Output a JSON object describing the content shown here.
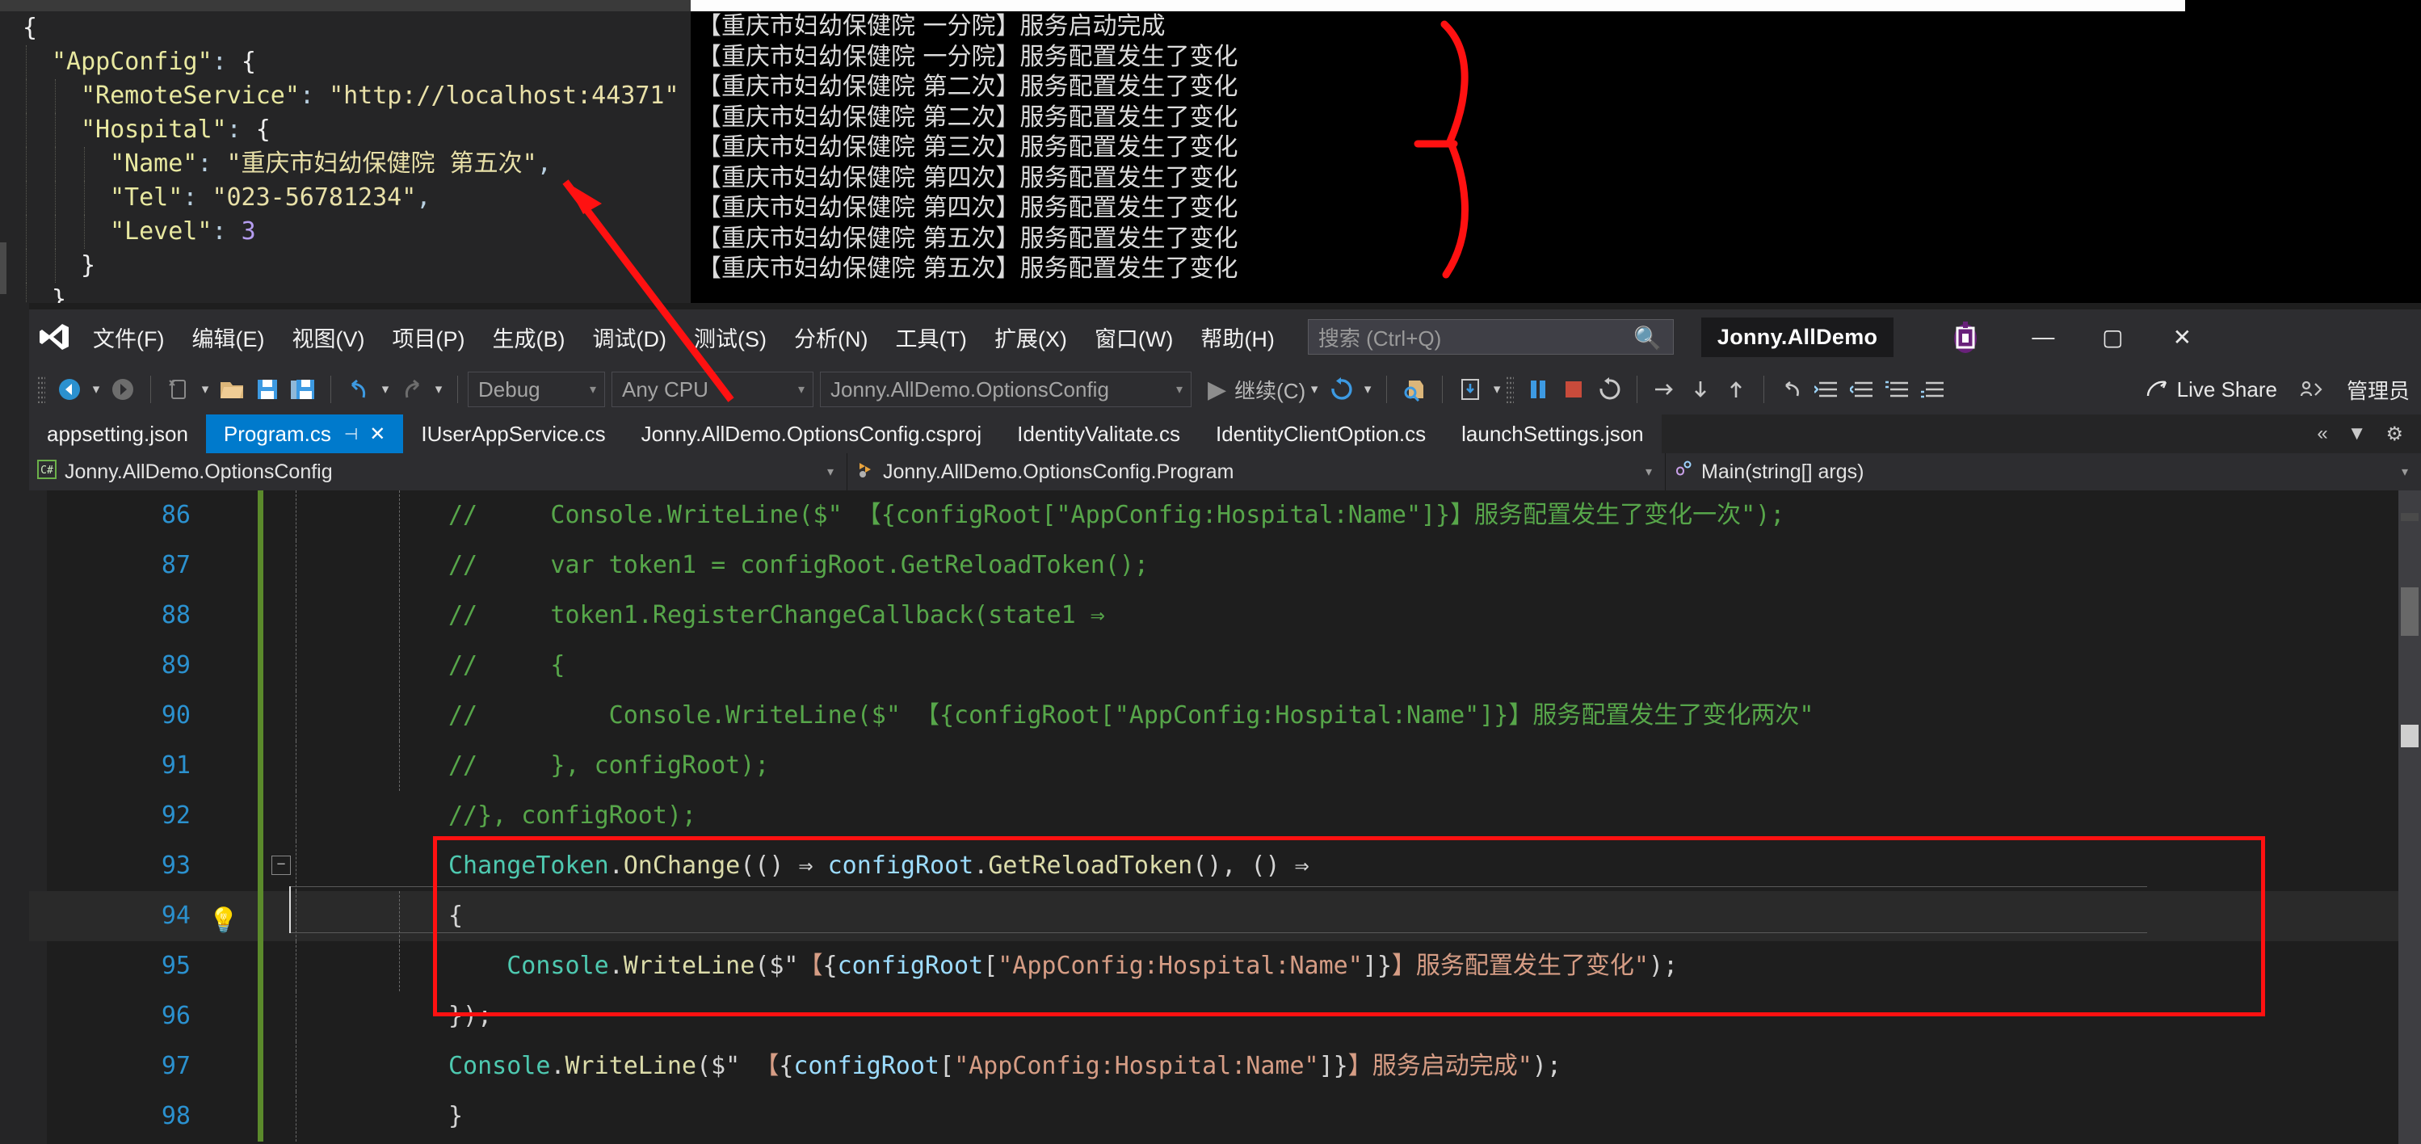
{
  "json_editor": {
    "name": "appsetting.json",
    "lines": [
      {
        "indent": 0,
        "segs": [
          {
            "c": "j-brace",
            "t": "{"
          }
        ]
      },
      {
        "indent": 1,
        "segs": [
          {
            "c": "j-key",
            "t": "\"AppConfig\""
          },
          {
            "c": "j-punct",
            "t": ": "
          },
          {
            "c": "j-brace",
            "t": "{"
          }
        ]
      },
      {
        "indent": 2,
        "segs": [
          {
            "c": "j-key",
            "t": "\"RemoteService\""
          },
          {
            "c": "j-punct",
            "t": ": "
          },
          {
            "c": "j-str",
            "t": "\"http://localhost:44371\""
          }
        ]
      },
      {
        "indent": 2,
        "segs": [
          {
            "c": "j-key",
            "t": "\"Hospital\""
          },
          {
            "c": "j-punct",
            "t": ": "
          },
          {
            "c": "j-brace",
            "t": "{"
          }
        ]
      },
      {
        "indent": 3,
        "segs": [
          {
            "c": "j-key",
            "t": "\"Name\""
          },
          {
            "c": "j-punct",
            "t": ": "
          },
          {
            "c": "j-str",
            "t": "\"重庆市妇幼保健院 第五次\""
          },
          {
            "c": "j-punct",
            "t": ","
          }
        ]
      },
      {
        "indent": 3,
        "segs": [
          {
            "c": "j-key",
            "t": "\"Tel\""
          },
          {
            "c": "j-punct",
            "t": ": "
          },
          {
            "c": "j-str",
            "t": "\"023-56781234\""
          },
          {
            "c": "j-punct",
            "t": ","
          }
        ]
      },
      {
        "indent": 3,
        "segs": [
          {
            "c": "j-key",
            "t": "\"Level\""
          },
          {
            "c": "j-punct",
            "t": ": "
          },
          {
            "c": "j-num",
            "t": "3"
          }
        ]
      },
      {
        "indent": 2,
        "segs": [
          {
            "c": "j-brace",
            "t": "}"
          }
        ]
      },
      {
        "indent": 1,
        "segs": [
          {
            "c": "j-brace",
            "t": "}"
          },
          {
            "c": "j-punct",
            "t": ","
          }
        ]
      }
    ]
  },
  "console": {
    "lines": [
      "【重庆市妇幼保健院 一分院】服务启动完成",
      "【重庆市妇幼保健院 一分院】服务配置发生了变化",
      "【重庆市妇幼保健院 第二次】服务配置发生了变化",
      "【重庆市妇幼保健院 第二次】服务配置发生了变化",
      "【重庆市妇幼保健院 第三次】服务配置发生了变化",
      "【重庆市妇幼保健院 第四次】服务配置发生了变化",
      "【重庆市妇幼保健院 第四次】服务配置发生了变化",
      "【重庆市妇幼保健院 第五次】服务配置发生了变化",
      "【重庆市妇幼保健院 第五次】服务配置发生了变化"
    ]
  },
  "vs": {
    "menu": [
      {
        "label": "文件(F)"
      },
      {
        "label": "编辑(E)"
      },
      {
        "label": "视图(V)"
      },
      {
        "label": "项目(P)"
      },
      {
        "label": "生成(B)"
      },
      {
        "label": "调试(D)"
      },
      {
        "label": "测试(S)"
      },
      {
        "label": "分析(N)"
      },
      {
        "label": "工具(T)"
      },
      {
        "label": "扩展(X)"
      },
      {
        "label": "窗口(W)"
      },
      {
        "label": "帮助(H)"
      }
    ],
    "search": {
      "placeholder": "搜索 (Ctrl+Q)",
      "icon": "search-icon"
    },
    "project_name": "Jonny.AllDemo",
    "window_buttons": {
      "minimize": "—",
      "maximize": "▢",
      "close": "✕"
    },
    "live_share": "Live Share",
    "admin_label": "管理员",
    "toolbar": {
      "configuration": "Debug",
      "platform": "Any CPU",
      "startup_project": "Jonny.AllDemo.OptionsConfig",
      "continue_label": "继续(C)"
    },
    "tabs": [
      {
        "label": "appsetting.json",
        "active": false
      },
      {
        "label": "Program.cs",
        "active": true,
        "pin": "⊣",
        "close": "✕"
      },
      {
        "label": "IUserAppService.cs",
        "active": false
      },
      {
        "label": "Jonny.AllDemo.OptionsConfig.csproj",
        "active": false
      },
      {
        "label": "IdentityValitate.cs",
        "active": false
      },
      {
        "label": "IdentityClientOption.cs",
        "active": false
      },
      {
        "label": "launchSettings.json",
        "active": false
      }
    ],
    "tab_overflow": {
      "chevrons": "«",
      "dropdown": "▼",
      "gear": "⚙"
    },
    "breadcrumbs": [
      {
        "icon": "csharp-project-icon",
        "label": "Jonny.AllDemo.OptionsConfig"
      },
      {
        "icon": "class-icon",
        "label": "Jonny.AllDemo.OptionsConfig.Program"
      },
      {
        "icon": "method-icon",
        "label": "Main(string[] args)"
      }
    ],
    "editor": {
      "first_line_number": 86,
      "current_line": 94,
      "lightbulb_line": 94,
      "code_lines": [
        {
          "n": 86,
          "indent_guides": [
            0,
            1
          ],
          "changed": true,
          "segs": [
            {
              "c": "cm",
              "t": "//     Console.WriteLine($\" 【{configRoot[\"AppConfig:Hospital:Name\"]}】服务配置发生了变化一次\");"
            }
          ]
        },
        {
          "n": 87,
          "indent_guides": [
            0,
            1
          ],
          "changed": true,
          "segs": [
            {
              "c": "cm",
              "t": "//     var token1 = configRoot.GetReloadToken();"
            }
          ]
        },
        {
          "n": 88,
          "indent_guides": [
            0,
            1
          ],
          "changed": true,
          "segs": [
            {
              "c": "cm",
              "t": "//     token1.RegisterChangeCallback(state1 ⇒"
            }
          ]
        },
        {
          "n": 89,
          "indent_guides": [
            0,
            1
          ],
          "changed": true,
          "segs": [
            {
              "c": "cm",
              "t": "//     {"
            }
          ]
        },
        {
          "n": 90,
          "indent_guides": [
            0,
            1
          ],
          "changed": true,
          "segs": [
            {
              "c": "cm",
              "t": "//         Console.WriteLine($\" 【{configRoot[\"AppConfig:Hospital:Name\"]}】服务配置发生了变化两次\""
            }
          ]
        },
        {
          "n": 91,
          "indent_guides": [
            0,
            1
          ],
          "changed": true,
          "segs": [
            {
              "c": "cm",
              "t": "//     }, configRoot);"
            }
          ]
        },
        {
          "n": 92,
          "indent_guides": [
            0
          ],
          "changed": true,
          "segs": [
            {
              "c": "cm",
              "t": "//}, configRoot);"
            }
          ]
        },
        {
          "n": 93,
          "indent_guides": [
            0
          ],
          "changed": true,
          "collapse": true,
          "segs": [
            {
              "c": "typ",
              "t": "ChangeToken"
            },
            {
              "c": "pl",
              "t": "."
            },
            {
              "c": "mth",
              "t": "OnChange"
            },
            {
              "c": "pl",
              "t": "(() ⇒ "
            },
            {
              "c": "var",
              "t": "configRoot"
            },
            {
              "c": "pl",
              "t": "."
            },
            {
              "c": "mth",
              "t": "GetReloadToken"
            },
            {
              "c": "pl",
              "t": "(), () ⇒"
            }
          ]
        },
        {
          "n": 94,
          "indent_guides": [
            0,
            1
          ],
          "changed": true,
          "current": true,
          "bulb": true,
          "segs": [
            {
              "c": "pl",
              "t": "{"
            }
          ]
        },
        {
          "n": 95,
          "indent_guides": [
            0,
            1
          ],
          "changed": true,
          "segs": [
            {
              "c": "pl",
              "t": "    "
            },
            {
              "c": "typ",
              "t": "Console"
            },
            {
              "c": "pl",
              "t": "."
            },
            {
              "c": "mth",
              "t": "WriteLine"
            },
            {
              "c": "pl",
              "t": "($\""
            },
            {
              "c": "str",
              "t": "【"
            },
            {
              "c": "pl",
              "t": "{"
            },
            {
              "c": "var",
              "t": "configRoot"
            },
            {
              "c": "pl",
              "t": "["
            },
            {
              "c": "str",
              "t": "\"AppConfig:Hospital:Name\""
            },
            {
              "c": "pl",
              "t": "]}"
            },
            {
              "c": "str",
              "t": "】服务配置发生了变化\""
            },
            {
              "c": "pl",
              "t": ");"
            }
          ]
        },
        {
          "n": 96,
          "indent_guides": [
            0
          ],
          "changed": true,
          "segs": [
            {
              "c": "pl",
              "t": "});"
            }
          ]
        },
        {
          "n": 97,
          "indent_guides": [
            0
          ],
          "changed": true,
          "segs": [
            {
              "c": "typ",
              "t": "Console"
            },
            {
              "c": "pl",
              "t": "."
            },
            {
              "c": "mth",
              "t": "WriteLine"
            },
            {
              "c": "pl",
              "t": "($\" "
            },
            {
              "c": "str",
              "t": "【"
            },
            {
              "c": "pl",
              "t": "{"
            },
            {
              "c": "var",
              "t": "configRoot"
            },
            {
              "c": "pl",
              "t": "["
            },
            {
              "c": "str",
              "t": "\"AppConfig:Hospital:Name\""
            },
            {
              "c": "pl",
              "t": "]}"
            },
            {
              "c": "str",
              "t": "】服务启动完成\""
            },
            {
              "c": "pl",
              "t": ");"
            }
          ]
        },
        {
          "n": 98,
          "indent_guides": [
            0
          ],
          "changed": true,
          "segs": [
            {
              "c": "pl",
              "t": "}"
            }
          ]
        }
      ]
    },
    "colors": {
      "accent": "#007acc",
      "titlebar": "#2d2d30",
      "editor_bg": "#1e1e1e",
      "annotation_red": "#ff1111",
      "change_bar_green": "#5b8a2b",
      "line_number": "#2b91cf"
    }
  }
}
